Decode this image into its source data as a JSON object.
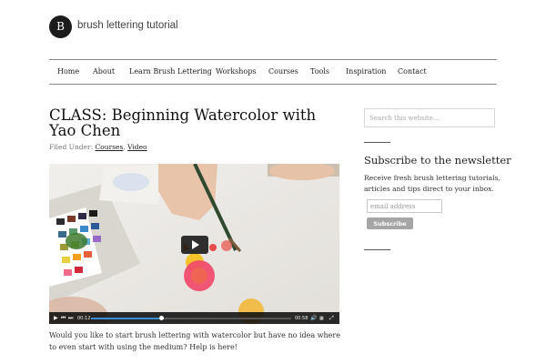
{
  "site": {
    "logo_letter": "B",
    "title": "brush lettering tutorial"
  },
  "nav": {
    "items": [
      {
        "label": "Home"
      },
      {
        "label": "About"
      },
      {
        "label": "Learn Brush Lettering"
      },
      {
        "label": "Workshops"
      },
      {
        "label": "Courses"
      },
      {
        "label": "Tools"
      },
      {
        "label": "Inspiration"
      },
      {
        "label": "Contact"
      }
    ]
  },
  "post": {
    "title": "CLASS: Beginning Watercolor with Yao Chen",
    "meta_label": "Filed Under:",
    "categories": [
      "Courses",
      "Video"
    ],
    "category_separator": ",",
    "excerpt": "Would you like to start brush lettering with watercolor but have no idea where to even start with using the medium? Help is here!"
  },
  "video": {
    "current_time": "00:12",
    "duration": "00:58",
    "progress": 0.35,
    "icons": [
      "play-icon",
      "rewind-icon",
      "forward-icon",
      "volume-icon",
      "captions-icon",
      "fullscreen-icon"
    ]
  },
  "sidebar": {
    "search_placeholder": "Search this website...",
    "newsletter": {
      "title": "Subscribe to the newsletter",
      "description": "Receive fresh brush lettering tutorials, articles and tips direct to your inbox.",
      "email_placeholder": "email address",
      "button_label": "Subscribe"
    }
  },
  "colors": {
    "logo_bg": "#1c1c1c",
    "progress": "#3b8ed6",
    "button_bg": "#a6a6a6"
  }
}
